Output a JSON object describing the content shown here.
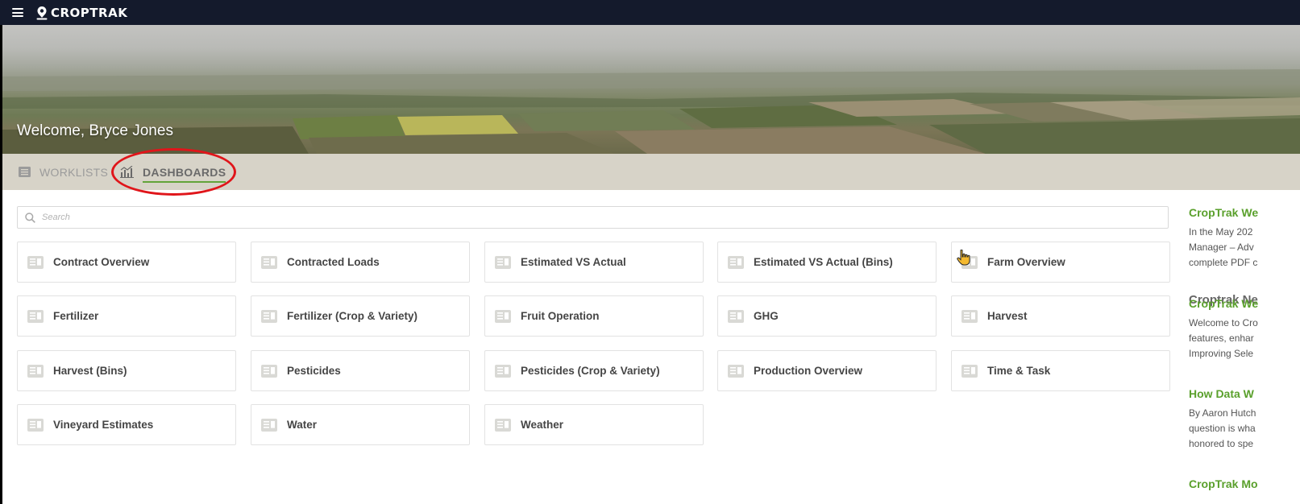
{
  "app": {
    "brand": "CROPTRAK"
  },
  "hero": {
    "welcome": "Welcome, Bryce Jones"
  },
  "tabs": [
    {
      "label": "WORKLISTS",
      "icon": "list-icon",
      "active": false
    },
    {
      "label": "DASHBOARDS",
      "icon": "bar-chart-icon",
      "active": true
    }
  ],
  "search": {
    "placeholder": "Search",
    "value": ""
  },
  "dashboards": [
    "Contract Overview",
    "Contracted Loads",
    "Estimated VS Actual",
    "Estimated VS Actual (Bins)",
    "Farm Overview",
    "Fertilizer",
    "Fertilizer (Crop & Variety)",
    "Fruit Operation",
    "GHG",
    "Harvest",
    "Harvest (Bins)",
    "Pesticides",
    "Pesticides (Crop & Variety)",
    "Production Overview",
    "Time & Task",
    "Vineyard Estimates",
    "Water",
    "Weather"
  ],
  "news": {
    "header": "Croptrak Ne",
    "items": [
      {
        "title": "CropTrak We",
        "lines": [
          "In the May 202",
          "Manager – Adv",
          "complete PDF c"
        ]
      },
      {
        "title": "CropTrak We",
        "lines": [
          "Welcome to Cro",
          "features, enhar",
          "Improving Sele"
        ]
      },
      {
        "title": "How Data W",
        "lines": [
          "By Aaron Hutch",
          "question is wha",
          "honored to spe"
        ]
      },
      {
        "title": "CropTrak Mo",
        "lines": []
      }
    ]
  },
  "colors": {
    "topbar": "#141a2c",
    "accent_green": "#5aa02c",
    "tab_bar": "#d7d3c8",
    "annotation_red": "#e0151a"
  }
}
